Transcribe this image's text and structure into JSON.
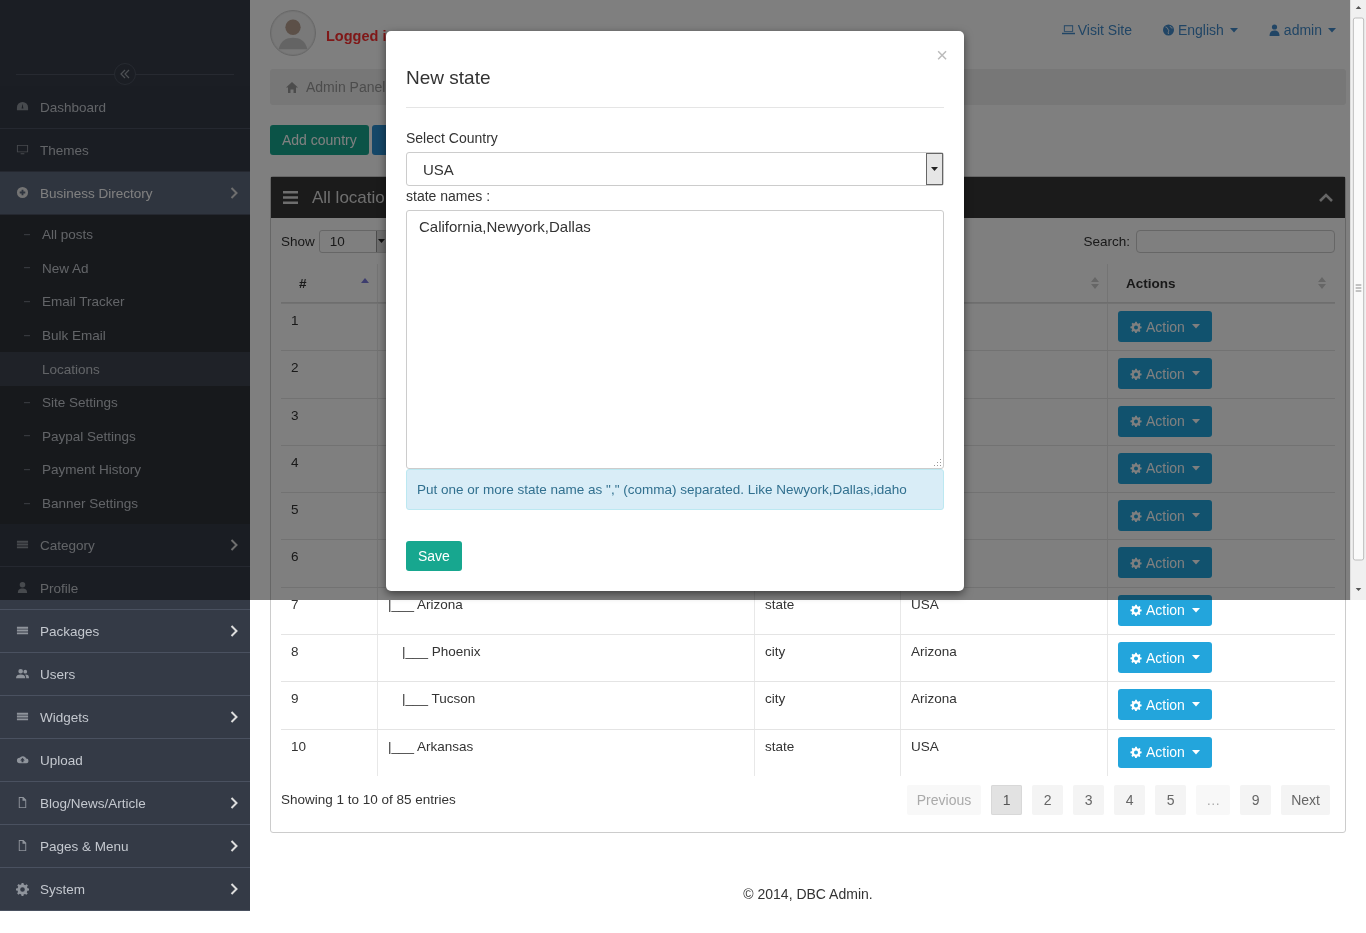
{
  "sidebar": {
    "items": [
      {
        "label": "Dashboard",
        "selected": false,
        "has_submenu": false
      },
      {
        "label": "Themes",
        "selected": false,
        "has_submenu": false
      },
      {
        "label": "Business Directory",
        "selected": true,
        "has_submenu": true,
        "children": [
          {
            "label": "All posts",
            "selected": false
          },
          {
            "label": "New Ad",
            "selected": false
          },
          {
            "label": "Email Tracker",
            "selected": false
          },
          {
            "label": "Bulk Email",
            "selected": false
          },
          {
            "label": "Locations",
            "selected": true
          },
          {
            "label": "Site Settings",
            "selected": false
          },
          {
            "label": "Paypal Settings",
            "selected": false
          },
          {
            "label": "Payment History",
            "selected": false
          },
          {
            "label": "Banner Settings",
            "selected": false
          }
        ]
      },
      {
        "label": "Category",
        "selected": false,
        "has_submenu": true
      },
      {
        "label": "Profile",
        "selected": false,
        "has_submenu": false
      },
      {
        "label": "Packages",
        "selected": false,
        "has_submenu": true
      },
      {
        "label": "Users",
        "selected": false,
        "has_submenu": false
      },
      {
        "label": "Widgets",
        "selected": false,
        "has_submenu": true
      },
      {
        "label": "Upload",
        "selected": false,
        "has_submenu": false
      },
      {
        "label": "Blog/News/Article",
        "selected": false,
        "has_submenu": true
      },
      {
        "label": "Pages & Menu",
        "selected": false,
        "has_submenu": true
      },
      {
        "label": "System",
        "selected": false,
        "has_submenu": true
      }
    ]
  },
  "header": {
    "user_text": "Logged i",
    "links": [
      {
        "label": "Visit Site",
        "has_caret": false
      },
      {
        "label": "English",
        "has_caret": true
      },
      {
        "label": "admin",
        "has_caret": true
      }
    ]
  },
  "breadcrumb": [
    "Admin Panel"
  ],
  "toolbar_buttons": [
    {
      "label": "Add country",
      "kind": "success"
    },
    {
      "kind": "primary"
    }
  ],
  "panel": {
    "title": "All locatio",
    "show_label": "Show",
    "page_size": "10",
    "search_label": "Search:",
    "table": {
      "columns": [
        {
          "label": "#",
          "sorted": true
        },
        {},
        {},
        {
          "sorted": false
        },
        {
          "label": "Actions",
          "sorted": false
        }
      ],
      "rows": [
        {
          "number": "1",
          "action": "Action"
        },
        {
          "number": "2",
          "action": "Action"
        },
        {
          "number": "3",
          "action": "Action"
        },
        {
          "number": "4",
          "action": "Action"
        },
        {
          "number": "5",
          "action": "Action"
        },
        {
          "number": "6",
          "action": "Action"
        },
        {
          "number": "7",
          "name": "|___ Arizona",
          "type": "state",
          "parent": "USA",
          "action": "Action",
          "children": [
            {
              "number": "8",
              "name": "|___ Phoenix",
              "type": "city",
              "parent": "Arizona",
              "action": "Action"
            },
            {
              "number": "9",
              "name": "|___ Tucson",
              "type": "city",
              "parent": "Arizona",
              "action": "Action"
            }
          ]
        },
        {
          "number": "10",
          "name": "|___ Arkansas",
          "type": "state",
          "parent": "USA",
          "action": "Action"
        }
      ]
    },
    "info": "Showing 1 to 10 of 85 entries",
    "pagination": [
      {
        "label": "Previous",
        "selected": false,
        "disabled": true
      },
      {
        "label": "1",
        "selected": true,
        "disabled": false
      },
      {
        "label": "2",
        "selected": false,
        "disabled": false
      },
      {
        "label": "3",
        "selected": false,
        "disabled": false
      },
      {
        "label": "4",
        "selected": false,
        "disabled": false
      },
      {
        "label": "5",
        "selected": false,
        "disabled": false
      },
      {
        "label": "…",
        "selected": false,
        "disabled": true
      },
      {
        "label": "9",
        "selected": false,
        "disabled": false
      },
      {
        "label": "Next",
        "selected": false,
        "disabled": false
      }
    ]
  },
  "footer": "© 2014, DBC Admin.",
  "modal": {
    "title": "New state",
    "close": "×",
    "country_label": "Select Country",
    "country": "USA",
    "names_label": "state names :",
    "names": "California,Newyork,Dallas",
    "hint": "Put one or more state name as \",\" (comma) separated. Like Newyork,Dallas,idaho",
    "save": "Save"
  }
}
